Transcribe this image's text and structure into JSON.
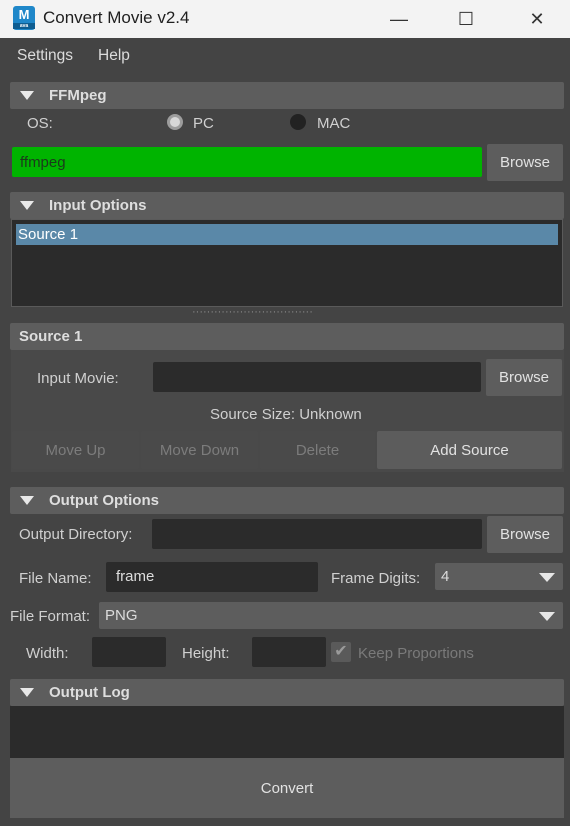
{
  "window": {
    "title": "Convert Movie v2.4",
    "icon_letter": "M",
    "icon_sub": "ava",
    "minimize_glyph": "—",
    "maximize_glyph": "☐",
    "close_glyph": "✕"
  },
  "menu": {
    "items": [
      "Settings",
      "Help"
    ]
  },
  "ffmpeg": {
    "header": "FFMpeg",
    "os_label": "OS:",
    "os_options": [
      {
        "label": "PC",
        "selected": true
      },
      {
        "label": "MAC",
        "selected": false
      }
    ],
    "path_value": "ffmpeg",
    "path_color": "#00b400",
    "browse_label": "Browse"
  },
  "input_options": {
    "header": "Input Options",
    "sources": [
      "Source 1"
    ],
    "splitter": "·································"
  },
  "source": {
    "header": "Source 1",
    "input_movie_label": "Input Movie:",
    "input_movie_value": "",
    "browse_label": "Browse",
    "source_size": "Source Size: Unknown",
    "move_up": "Move Up",
    "move_down": "Move Down",
    "delete": "Delete",
    "add_source": "Add Source"
  },
  "output_options": {
    "header": "Output Options",
    "output_dir_label": "Output Directory:",
    "output_dir_value": "",
    "browse_label": "Browse",
    "file_name_label": "File Name:",
    "file_name_value": "frame",
    "frame_digits_label": "Frame Digits:",
    "frame_digits_value": "4",
    "file_format_label": "File Format:",
    "file_format_value": "PNG",
    "width_label": "Width:",
    "height_label": "Height:",
    "keep_proportions_label": "Keep Proportions",
    "keep_proportions_checked": true,
    "check_glyph": "✔"
  },
  "output_log": {
    "header": "Output Log"
  },
  "convert_label": "Convert"
}
